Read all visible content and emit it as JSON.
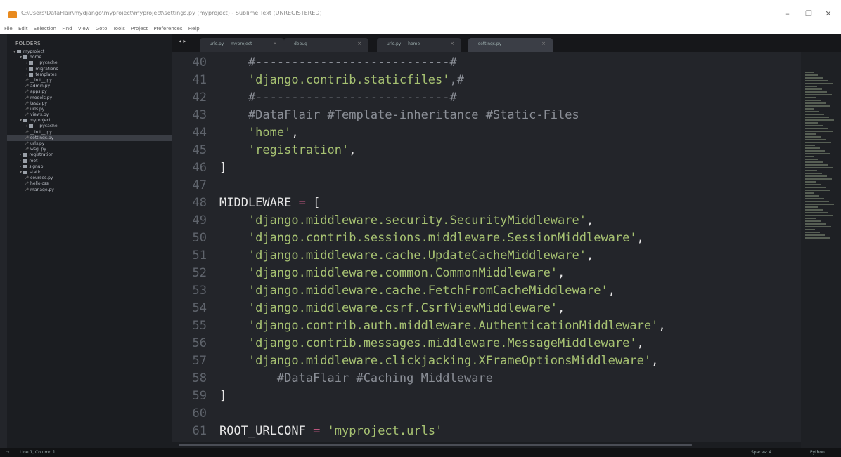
{
  "window": {
    "title": "C:\\Users\\DataFlair\\mydjango\\myproject\\myproject\\settings.py (myproject) - Sublime Text (UNREGISTERED)",
    "controls": [
      "–",
      "❐",
      "✕"
    ]
  },
  "menubar": [
    "File",
    "Edit",
    "Selection",
    "Find",
    "View",
    "Goto",
    "Tools",
    "Project",
    "Preferences",
    "Help"
  ],
  "sidebar": {
    "header": "FOLDERS",
    "tree": [
      {
        "label": "myproject",
        "indent": 1,
        "type": "folder",
        "arrow": "▾"
      },
      {
        "label": "home",
        "indent": 2,
        "type": "folder",
        "arrow": "▾"
      },
      {
        "label": "__pycache__",
        "indent": 3,
        "type": "folder",
        "arrow": "›"
      },
      {
        "label": "migrations",
        "indent": 3,
        "type": "folder",
        "arrow": "›"
      },
      {
        "label": "templates",
        "indent": 3,
        "type": "folder",
        "arrow": "›"
      },
      {
        "label": "__init__.py",
        "indent": 3,
        "type": "file"
      },
      {
        "label": "admin.py",
        "indent": 3,
        "type": "file"
      },
      {
        "label": "apps.py",
        "indent": 3,
        "type": "file"
      },
      {
        "label": "models.py",
        "indent": 3,
        "type": "file"
      },
      {
        "label": "tests.py",
        "indent": 3,
        "type": "file"
      },
      {
        "label": "urls.py",
        "indent": 3,
        "type": "file"
      },
      {
        "label": "views.py",
        "indent": 3,
        "type": "file"
      },
      {
        "label": "myproject",
        "indent": 2,
        "type": "folder",
        "arrow": "▾"
      },
      {
        "label": "__pycache__",
        "indent": 3,
        "type": "folder",
        "arrow": "›"
      },
      {
        "label": "__init__.py",
        "indent": 3,
        "type": "file"
      },
      {
        "label": "settings.py",
        "indent": 3,
        "type": "file",
        "selected": true
      },
      {
        "label": "urls.py",
        "indent": 3,
        "type": "file"
      },
      {
        "label": "wsgi.py",
        "indent": 3,
        "type": "file"
      },
      {
        "label": "registration",
        "indent": 2,
        "type": "folder",
        "arrow": "›"
      },
      {
        "label": "root",
        "indent": 2,
        "type": "folder",
        "arrow": "›"
      },
      {
        "label": "signup",
        "indent": 2,
        "type": "folder",
        "arrow": "›"
      },
      {
        "label": "static",
        "indent": 2,
        "type": "folder",
        "arrow": "▾"
      },
      {
        "label": "courses.py",
        "indent": 3,
        "type": "file"
      },
      {
        "label": "hello.css",
        "indent": 3,
        "type": "file"
      },
      {
        "label": "manage.py",
        "indent": 3,
        "type": "file"
      }
    ]
  },
  "tabbar": {
    "nav": "◂ ▸",
    "tabs": [
      {
        "label": "urls.py — myproject",
        "active": false
      },
      {
        "label": "debug",
        "active": false
      },
      {
        "label": "urls.py — home",
        "active": false
      },
      {
        "label": "settings.py",
        "active": true
      }
    ],
    "close": "×"
  },
  "editor": {
    "lines": [
      {
        "n": "40",
        "tokens": [
          {
            "t": "    #---------------------------#",
            "c": "com"
          }
        ]
      },
      {
        "n": "41",
        "tokens": [
          {
            "t": "    'django.contrib.staticfiles'",
            "c": "str"
          },
          {
            "t": ",#",
            "c": "com"
          }
        ]
      },
      {
        "n": "42",
        "tokens": [
          {
            "t": "    #---------------------------#",
            "c": "com"
          }
        ]
      },
      {
        "n": "43",
        "tokens": [
          {
            "t": "    #DataFlair #Template-inheritance #Static-Files",
            "c": "com"
          }
        ]
      },
      {
        "n": "44",
        "tokens": [
          {
            "t": "    'home'",
            "c": "str"
          },
          {
            "t": ",",
            "c": "txt"
          }
        ]
      },
      {
        "n": "45",
        "tokens": [
          {
            "t": "    'registration'",
            "c": "str"
          },
          {
            "t": ",",
            "c": "txt"
          }
        ]
      },
      {
        "n": "46",
        "tokens": [
          {
            "t": "]",
            "c": "br"
          }
        ]
      },
      {
        "n": "47",
        "tokens": []
      },
      {
        "n": "48",
        "tokens": [
          {
            "t": "MIDDLEWARE",
            "c": "txt"
          },
          {
            "t": " = ",
            "c": "op"
          },
          {
            "t": "[",
            "c": "br"
          }
        ]
      },
      {
        "n": "49",
        "tokens": [
          {
            "t": "    'django.middleware.security.SecurityMiddleware'",
            "c": "str"
          },
          {
            "t": ",",
            "c": "txt"
          }
        ]
      },
      {
        "n": "50",
        "tokens": [
          {
            "t": "    'django.contrib.sessions.middleware.SessionMiddleware'",
            "c": "str"
          },
          {
            "t": ",",
            "c": "txt"
          }
        ]
      },
      {
        "n": "51",
        "tokens": [
          {
            "t": "    'django.middleware.cache.UpdateCacheMiddleware'",
            "c": "str"
          },
          {
            "t": ",",
            "c": "txt"
          }
        ]
      },
      {
        "n": "52",
        "tokens": [
          {
            "t": "    'django.middleware.common.CommonMiddleware'",
            "c": "str"
          },
          {
            "t": ",",
            "c": "txt"
          }
        ]
      },
      {
        "n": "53",
        "tokens": [
          {
            "t": "    'django.middleware.cache.FetchFromCacheMiddleware'",
            "c": "str"
          },
          {
            "t": ",",
            "c": "txt"
          }
        ]
      },
      {
        "n": "54",
        "tokens": [
          {
            "t": "    'django.middleware.csrf.CsrfViewMiddleware'",
            "c": "str"
          },
          {
            "t": ",",
            "c": "txt"
          }
        ]
      },
      {
        "n": "55",
        "tokens": [
          {
            "t": "    'django.contrib.auth.middleware.AuthenticationMiddleware'",
            "c": "str"
          },
          {
            "t": ",",
            "c": "txt"
          }
        ]
      },
      {
        "n": "56",
        "tokens": [
          {
            "t": "    'django.contrib.messages.middleware.MessageMiddleware'",
            "c": "str"
          },
          {
            "t": ",",
            "c": "txt"
          }
        ]
      },
      {
        "n": "57",
        "tokens": [
          {
            "t": "    'django.middleware.clickjacking.XFrameOptionsMiddleware'",
            "c": "str"
          },
          {
            "t": ",",
            "c": "txt"
          }
        ]
      },
      {
        "n": "58",
        "tokens": [
          {
            "t": "        #DataFlair #Caching Middleware",
            "c": "com"
          }
        ]
      },
      {
        "n": "59",
        "tokens": [
          {
            "t": "]",
            "c": "br"
          }
        ]
      },
      {
        "n": "60",
        "tokens": []
      },
      {
        "n": "61",
        "tokens": [
          {
            "t": "ROOT_URLCONF",
            "c": "txt"
          },
          {
            "t": " = ",
            "c": "op"
          },
          {
            "t": "'myproject.urls'",
            "c": "str"
          }
        ]
      }
    ]
  },
  "statusbar": {
    "position": "Line 1, Column 1",
    "spaces": "Spaces: 4",
    "syntax": "Python"
  },
  "colors": {
    "background": "#23252a",
    "sidebar": "#1b1d21",
    "string": "#a7c272",
    "comment": "#8b8f97",
    "operator": "#d05c8a",
    "line_number": "#5f646c"
  }
}
